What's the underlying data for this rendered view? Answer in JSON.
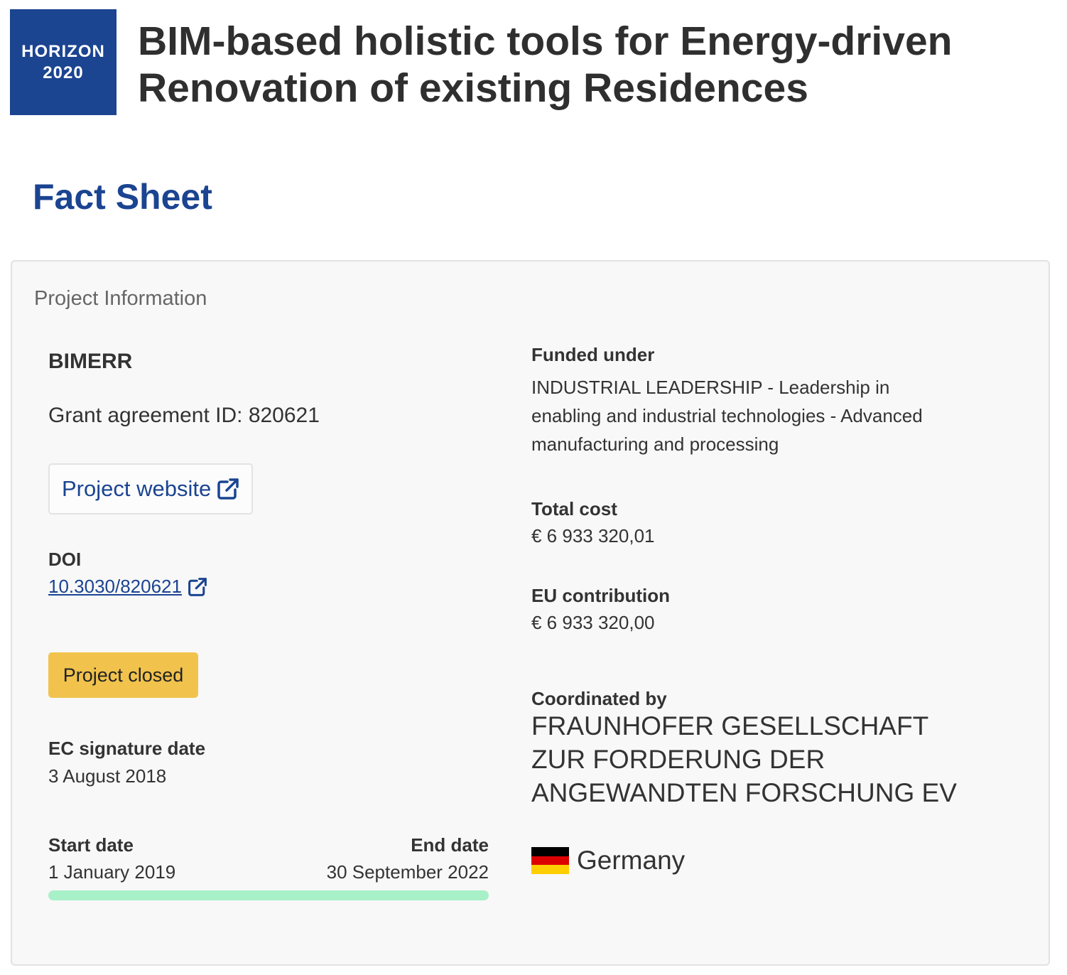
{
  "header": {
    "logo_line1": "HORIZON",
    "logo_line2": "2020",
    "title": "BIM-based holistic tools for Energy-driven Renovation of existing Residences"
  },
  "section_title": "Fact Sheet",
  "card": {
    "header": "Project Information",
    "acronym": "BIMERR",
    "grant_label": "Grant agreement ID:",
    "grant_id": "820621",
    "website_label": "Project website",
    "doi_label": "DOI",
    "doi_value": "10.3030/820621",
    "status": "Project closed",
    "signature_label": "EC signature date",
    "signature_date": "3 August 2018",
    "start_label": "Start date",
    "start_date": "1 January 2019",
    "end_label": "End date",
    "end_date": "30 September 2022",
    "progress_percent": 100,
    "funded_label": "Funded under",
    "funded_value": "INDUSTRIAL LEADERSHIP - Leadership in enabling and industrial technologies - Advanced manufacturing and processing",
    "total_cost_label": "Total cost",
    "total_cost_value": "€ 6 933 320,01",
    "eu_contribution_label": "EU contribution",
    "eu_contribution_value": "€ 6 933 320,00",
    "coordinated_label": "Coordinated by",
    "coordinator_name": "FRAUNHOFER GESELLSCHAFT ZUR FORDERUNG DER ANGEWANDTEN FORSCHUNG EV",
    "country": "Germany"
  },
  "colors": {
    "brand_blue": "#1b4491",
    "status_yellow": "#f1c34d",
    "progress_green": "#a7f0c8",
    "flag_black": "#000000",
    "flag_red": "#dd0000",
    "flag_gold": "#ffce00"
  },
  "icons": {
    "external_link": "external-link-icon",
    "flag": "germany-flag-icon"
  }
}
